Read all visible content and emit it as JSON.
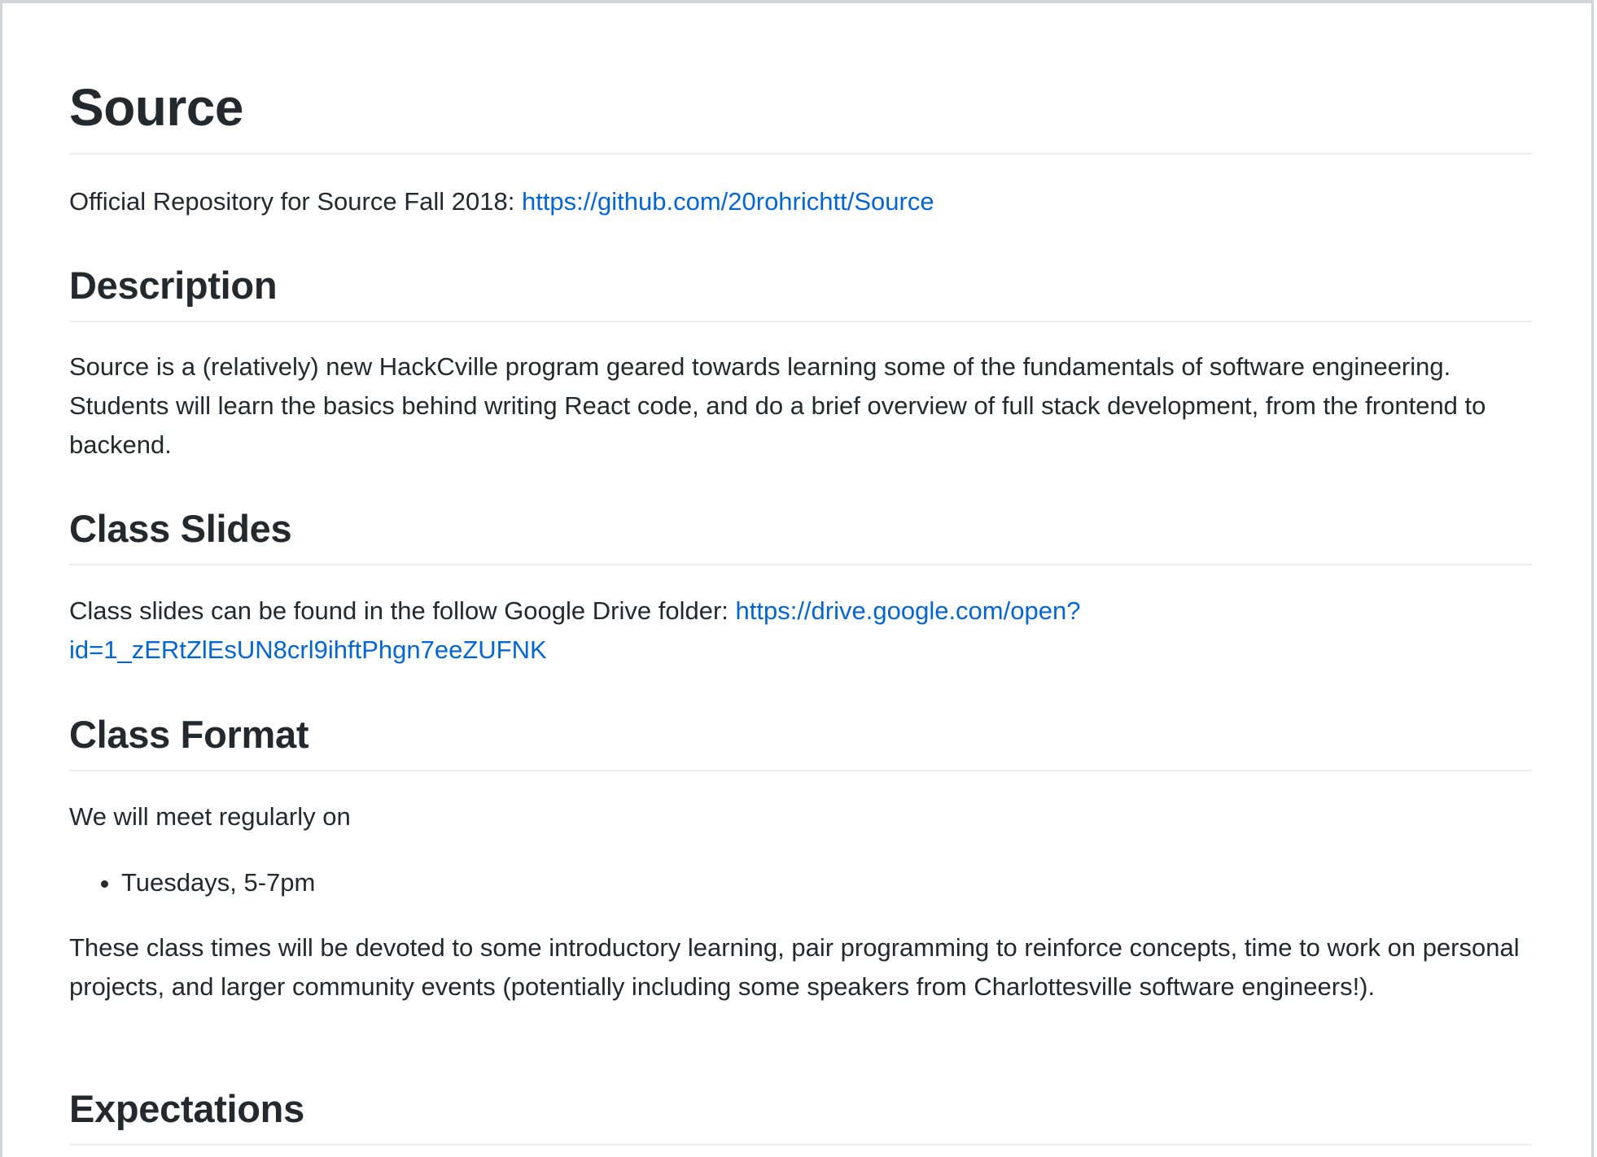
{
  "readme": {
    "title": "Source",
    "intro_text": "Official Repository for Source Fall 2018: ",
    "intro_link": "https://github.com/20rohrichtt/Source",
    "sections": {
      "description": {
        "heading": "Description",
        "body": "Source is a (relatively) new HackCville program geared towards learning some of the fundamentals of software engineering. Students will learn the basics behind writing React code, and do a brief overview of full stack development, from the frontend to backend."
      },
      "class_slides": {
        "heading": "Class Slides",
        "body_text": "Class slides can be found in the follow Google Drive folder: ",
        "link_line1": "https://drive.google.com/open?",
        "link_line2": "id=1_zERtZlEsUN8crl9ihftPhgn7eeZUFNK"
      },
      "class_format": {
        "heading": "Class Format",
        "intro": "We will meet regularly on",
        "schedule_items": [
          "Tuesdays, 5-7pm"
        ],
        "body": "These class times will be devoted to some introductory learning, pair programming to reinforce concepts, time to work on personal projects, and larger community events (potentially including some speakers from Charlottesville software engineers!)."
      },
      "expectations": {
        "heading": "Expectations"
      }
    }
  }
}
